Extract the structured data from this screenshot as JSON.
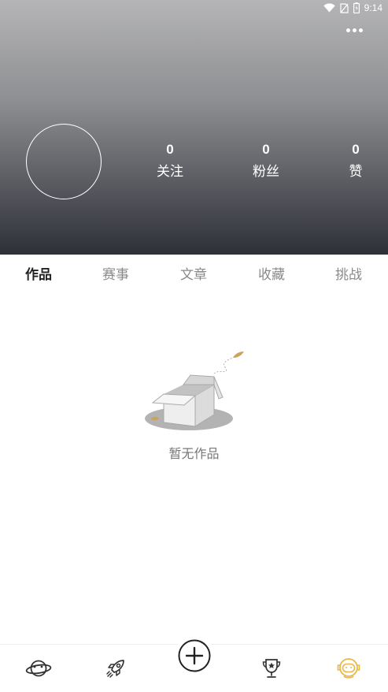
{
  "status_bar": {
    "time": "9:14",
    "icons": [
      "wifi-icon",
      "no-sim-icon",
      "battery-icon"
    ]
  },
  "header": {
    "more_icon": "more-dots-icon",
    "stats": {
      "follow": {
        "count": "0",
        "label": "关注"
      },
      "fans": {
        "count": "0",
        "label": "粉丝"
      },
      "likes": {
        "count": "0",
        "label": "赞"
      }
    }
  },
  "tabs": [
    {
      "label": "作品",
      "active": true
    },
    {
      "label": "赛事",
      "active": false
    },
    {
      "label": "文章",
      "active": false
    },
    {
      "label": "收藏",
      "active": false
    },
    {
      "label": "挑战",
      "active": false
    }
  ],
  "empty_state": {
    "text": "暂无作品",
    "icon": "empty-box-icon"
  },
  "bottom_nav": {
    "items": [
      "planet-icon",
      "rocket-icon",
      "add-icon",
      "trophy-icon",
      "astronaut-icon"
    ],
    "active_item": "astronaut-icon"
  },
  "colors": {
    "active_tab": "#222222",
    "inactive_tab": "#8a8a8a",
    "active_nav": "#e8b84a",
    "nav_icon": "#333333"
  }
}
